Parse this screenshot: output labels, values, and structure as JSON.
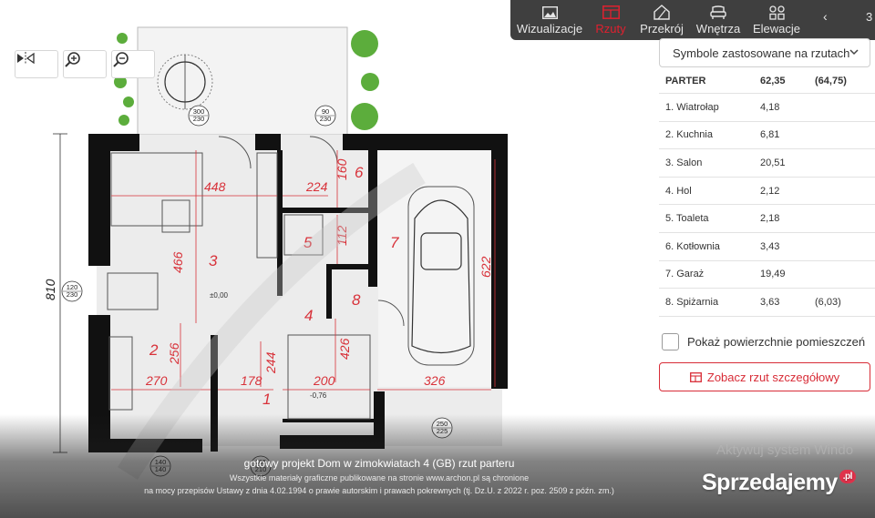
{
  "tabs": [
    {
      "label": "Wizualizacje",
      "icon": "image-icon",
      "active": false
    },
    {
      "label": "Rzuty",
      "icon": "floorplan-icon",
      "active": true
    },
    {
      "label": "Przekrój",
      "icon": "house-section-icon",
      "active": false
    },
    {
      "label": "Wnętrza",
      "icon": "armchair-icon",
      "active": false
    },
    {
      "label": "Elewacje",
      "icon": "elevation-grid-icon",
      "active": false
    }
  ],
  "tab_pager": {
    "prev_icon": "chevron-left-icon",
    "page": "3"
  },
  "map_controls": [
    {
      "name": "flip-icon"
    },
    {
      "name": "zoom-in-icon"
    },
    {
      "name": "zoom-out-icon"
    }
  ],
  "symbols_select": {
    "label": "Symbole zastosowane na rzutach",
    "icon": "chevron-down-icon"
  },
  "rooms": {
    "header": {
      "name": "PARTER",
      "area": "62,35",
      "extra": "(64,75)"
    },
    "items": [
      {
        "name": "1. Wiatrołap",
        "area": "4,18",
        "extra": ""
      },
      {
        "name": "2. Kuchnia",
        "area": "6,81",
        "extra": ""
      },
      {
        "name": "3. Salon",
        "area": "20,51",
        "extra": ""
      },
      {
        "name": "4. Hol",
        "area": "2,12",
        "extra": ""
      },
      {
        "name": "5. Toaleta",
        "area": "2,18",
        "extra": ""
      },
      {
        "name": "6. Kotłownia",
        "area": "3,43",
        "extra": ""
      },
      {
        "name": "7. Garaż",
        "area": "19,49",
        "extra": ""
      },
      {
        "name": "8. Spiżarnia",
        "area": "3,63",
        "extra": "(6,03)"
      }
    ]
  },
  "show_area_checkbox": {
    "label": "Pokaż powierzchnie pomieszczeń",
    "checked": false
  },
  "detail_button": {
    "label": "Zobacz rzut szczegółowy",
    "icon": "plan-icon"
  },
  "plan": {
    "room_numbers": [
      "1",
      "2",
      "3",
      "4",
      "5",
      "6",
      "7",
      "8"
    ],
    "dimensions": [
      "448",
      "224",
      "160",
      "466",
      "112",
      "622",
      "810",
      "256",
      "244",
      "426",
      "270",
      "178",
      "200",
      "326"
    ],
    "openings": [
      "300\n230",
      "90\n230",
      "120\n230",
      "250\n225",
      "140\n140",
      "105\n210"
    ],
    "levels": [
      "±0,00",
      "-0,76"
    ]
  },
  "caption": {
    "title": "gotowy projekt Dom w zimokwiatach 4 (GB) rzut parteru",
    "line1": "Wszystkie materiały graficzne publikowane na stronie www.archon.pl są chronione",
    "line2": "na mocy przepisów Ustawy z dnia 4.02.1994 o prawie autorskim i prawach pokrewnych (tj. Dz.U. z 2022 r. poz. 2509 z późn. zm.)"
  },
  "watermark_text": "Aktywuj system Windo",
  "brand": {
    "name": "Sprzedajemy",
    "suffix": ".pl"
  },
  "colors": {
    "accent": "#e0202f",
    "tabbar": "#3f3f3f",
    "plan_red": "#d8323a"
  }
}
